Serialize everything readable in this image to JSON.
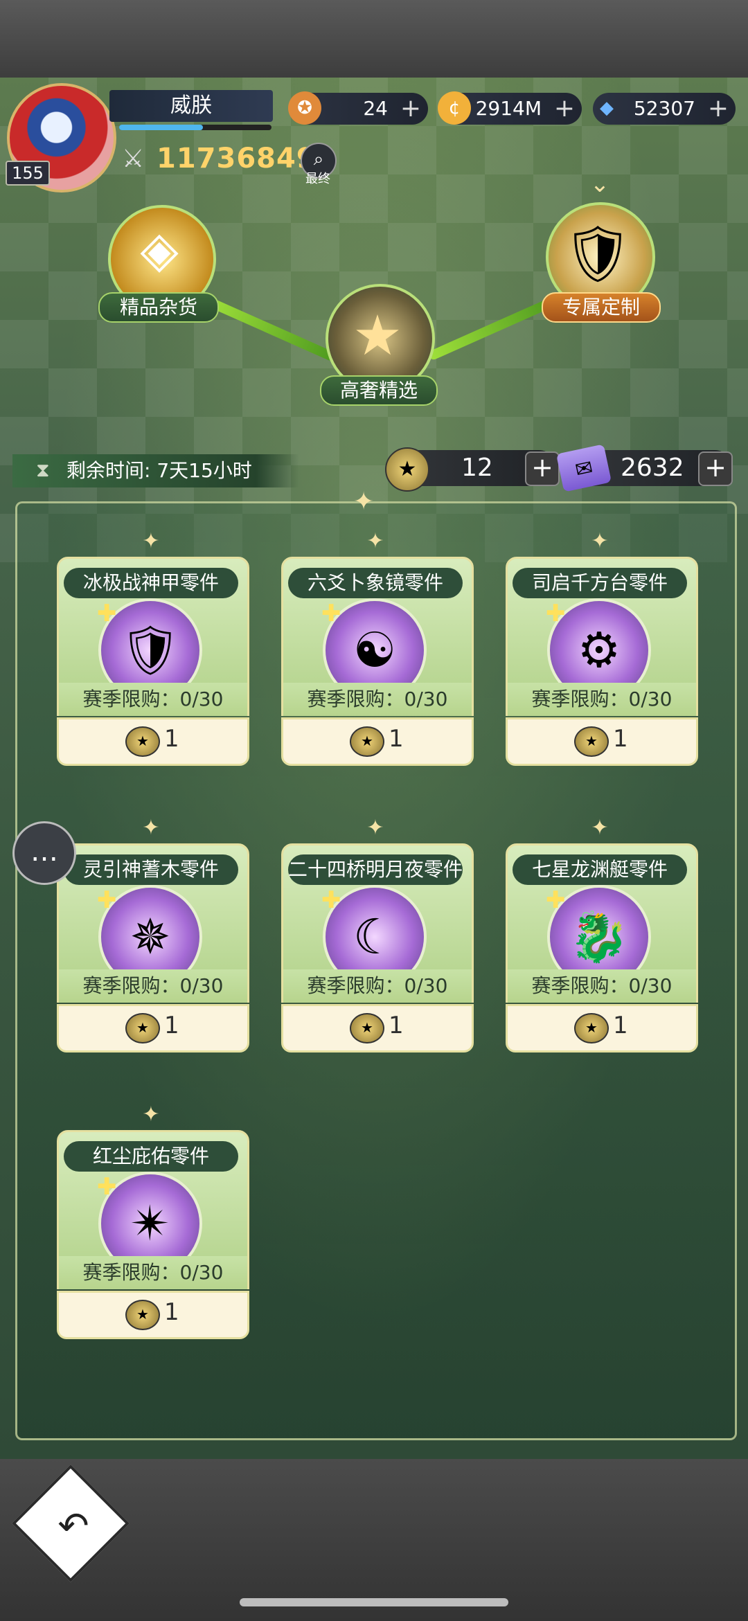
{
  "player": {
    "name": "威朕",
    "level": "155",
    "power": "117368492",
    "exp_fraction": 0.55,
    "search_label": "最终"
  },
  "resources": [
    {
      "name": "badge-currency",
      "value": "24",
      "color": "#e08a3a"
    },
    {
      "name": "gold-coin",
      "value": "2914M",
      "color": "#f2b13a"
    },
    {
      "name": "diamond",
      "value": "52307",
      "color": "#6fb5ff"
    }
  ],
  "shop_nodes": [
    {
      "label": "精品杂货",
      "active": false
    },
    {
      "label": "高奢精选",
      "active": false
    },
    {
      "label": "专属定制",
      "active": true
    }
  ],
  "timer": {
    "text": "剩余时间: 7天15小时"
  },
  "currencies": [
    {
      "name": "star-coin",
      "value": "12"
    },
    {
      "name": "ticket",
      "value": "2632"
    }
  ],
  "items": [
    {
      "name": "冰极战神甲零件",
      "limit": "赛季限购：0/30",
      "price": "1",
      "glyph": "🛡"
    },
    {
      "name": "六爻卜象镜零件",
      "limit": "赛季限购：0/30",
      "price": "1",
      "glyph": "☯"
    },
    {
      "name": "司启千方台零件",
      "limit": "赛季限购：0/30",
      "price": "1",
      "glyph": "⚙"
    },
    {
      "name": "灵引神蓍木零件",
      "limit": "赛季限购：0/30",
      "price": "1",
      "glyph": "✵"
    },
    {
      "name": "二十四桥明月夜零件",
      "limit": "赛季限购：0/30",
      "price": "1",
      "glyph": "☾"
    },
    {
      "name": "七星龙渊艇零件",
      "limit": "赛季限购：0/30",
      "price": "1",
      "glyph": "🐉"
    },
    {
      "name": "红尘庇佑零件",
      "limit": "赛季限购：0/30",
      "price": "1",
      "glyph": "✴"
    }
  ],
  "ui": {
    "plus": "+",
    "chat_icon": "…",
    "back_icon": "↶"
  }
}
